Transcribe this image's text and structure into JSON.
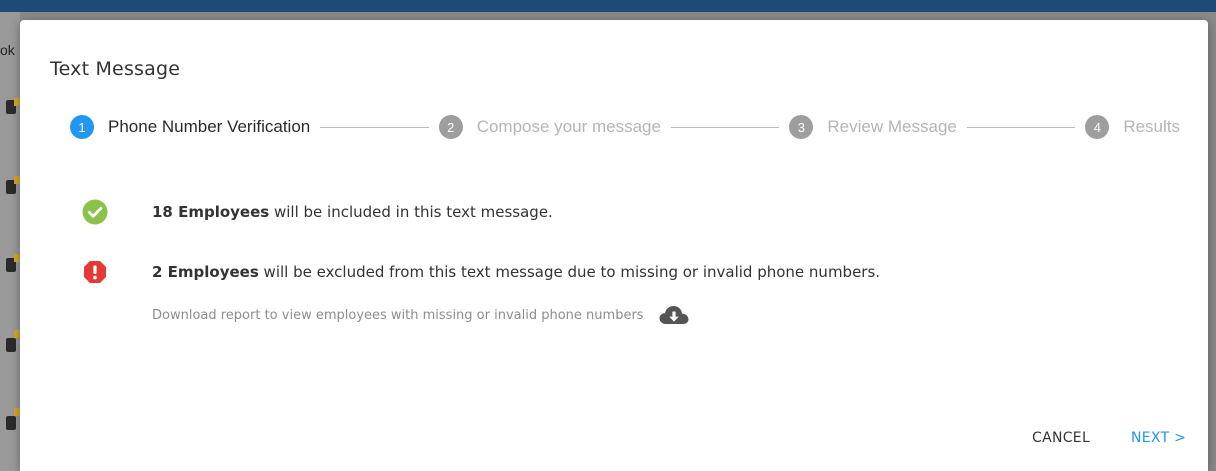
{
  "background": {
    "partial_text": "ok"
  },
  "dialog": {
    "title": "Text Message"
  },
  "stepper": {
    "steps": [
      {
        "number": "1",
        "label": "Phone Number Verification",
        "state": "active"
      },
      {
        "number": "2",
        "label": "Compose your message",
        "state": "inactive"
      },
      {
        "number": "3",
        "label": "Review Message",
        "state": "inactive"
      },
      {
        "number": "4",
        "label": "Results",
        "state": "inactive"
      }
    ]
  },
  "included": {
    "icon": "check-circle-icon",
    "count_label": "18 Employees",
    "text": " will be included in this text message."
  },
  "excluded": {
    "icon": "error-octagon-icon",
    "count_label": "2 Employees",
    "text": " will be excluded from this text message due to missing or invalid phone numbers."
  },
  "report": {
    "text": "Download report to view employees with missing or invalid phone numbers",
    "icon": "cloud-download-icon"
  },
  "footer": {
    "cancel_label": "CANCEL",
    "next_label": "NEXT >"
  },
  "colors": {
    "accent": "#2196f3",
    "success": "#8bc34a",
    "error": "#e53935",
    "step_inactive": "#9e9e9e"
  }
}
